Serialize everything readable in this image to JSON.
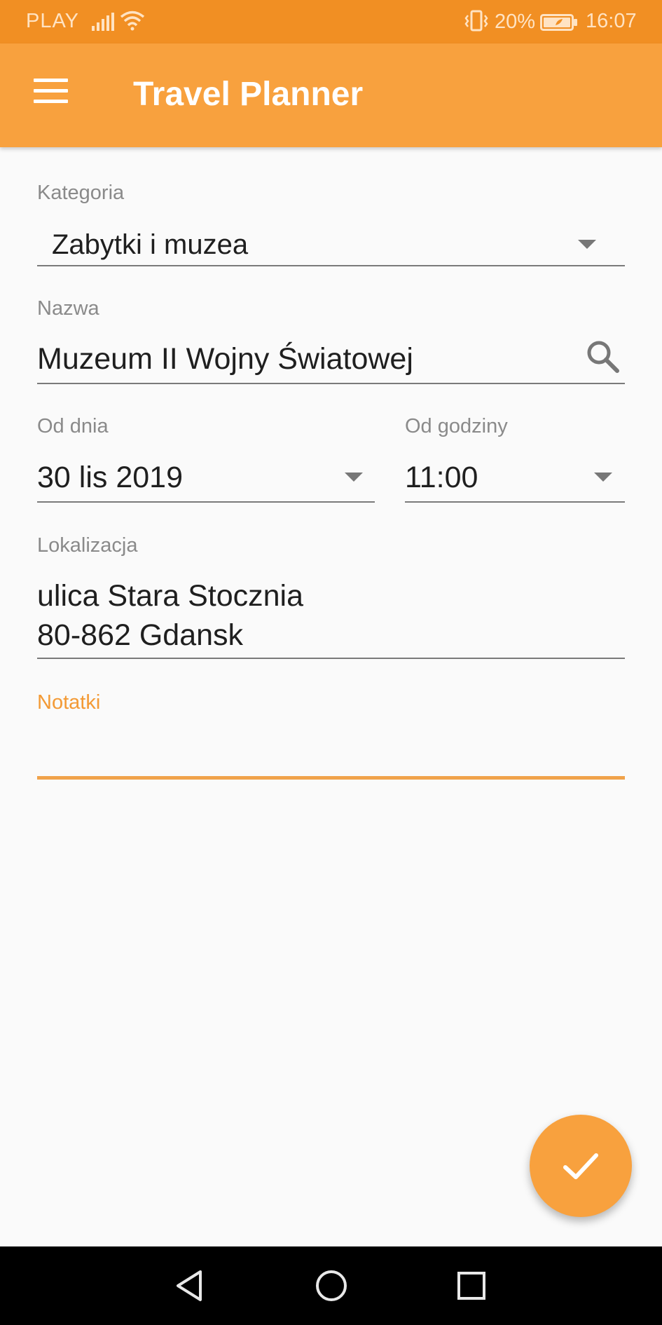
{
  "status_bar": {
    "carrier": "PLAY",
    "battery_percent": "20%",
    "time": "16:07",
    "icons": [
      "signal-icon",
      "wifi-icon",
      "vibrate-icon",
      "battery-saver-icon"
    ]
  },
  "app_bar": {
    "title": "Travel Planner",
    "menu_icon": "hamburger-menu-icon"
  },
  "form": {
    "category": {
      "label": "Kategoria",
      "value": "Zabytki i muzea"
    },
    "name": {
      "label": "Nazwa",
      "value": "Muzeum II Wojny Światowej",
      "icon": "search-icon"
    },
    "date": {
      "label": "Od dnia",
      "value": "30 lis 2019"
    },
    "time": {
      "label": "Od godziny",
      "value": "11:00"
    },
    "location": {
      "label": "Lokalizacja",
      "line1": "ulica Stara Stocznia",
      "line2": "80-862 Gdansk"
    },
    "notes": {
      "label": "Notatki",
      "value": ""
    }
  },
  "fab": {
    "icon": "check-icon"
  },
  "nav_bar": {
    "buttons": [
      "back-icon",
      "home-icon",
      "recent-apps-icon"
    ]
  },
  "colors": {
    "status_bar": "#f18f23",
    "app_bar": "#f8a13e",
    "accent": "#f0a24a",
    "background": "#fafafa",
    "nav_bar": "#000000"
  }
}
